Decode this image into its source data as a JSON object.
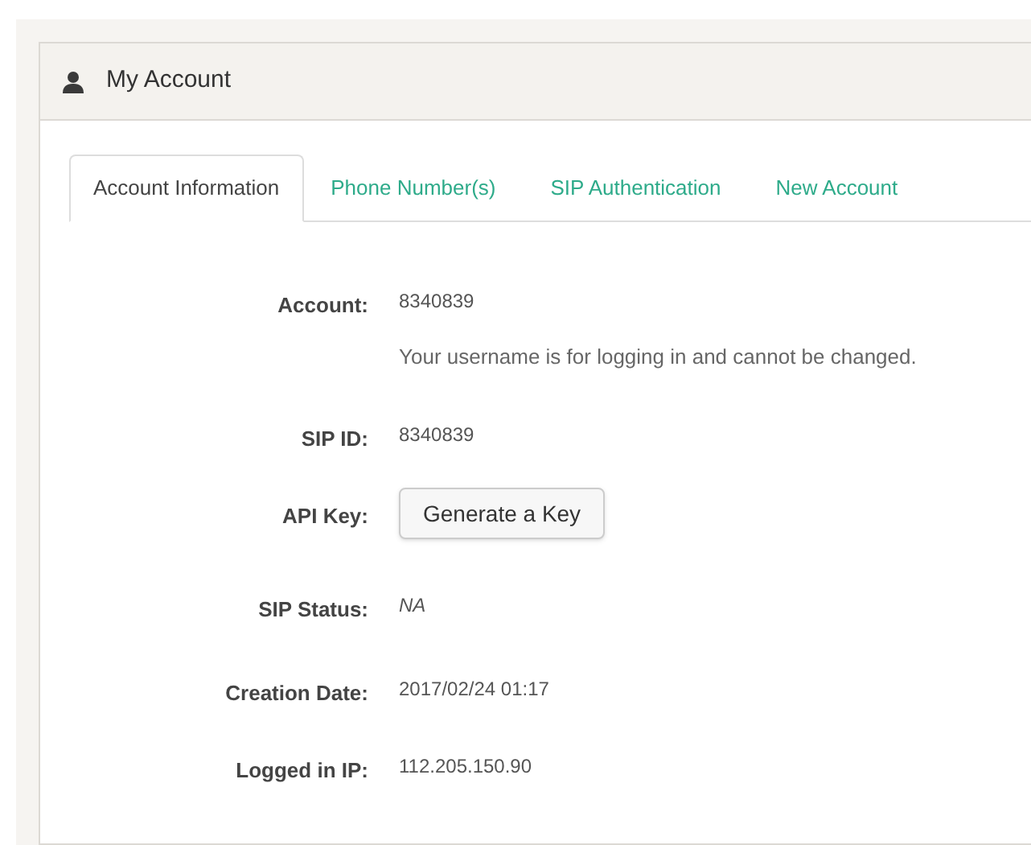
{
  "panel": {
    "title": "My Account"
  },
  "tabs": [
    {
      "label": "Account Information",
      "selected": true
    },
    {
      "label": "Phone Number(s)",
      "selected": false
    },
    {
      "label": "SIP Authentication",
      "selected": false
    },
    {
      "label": "New Account",
      "selected": false
    }
  ],
  "fields": [
    {
      "kind": "text",
      "label": "Account:",
      "value": "8340839",
      "note": "Your username is for logging in and cannot be changed."
    },
    {
      "kind": "text",
      "label": "SIP ID:",
      "value": "8340839"
    },
    {
      "kind": "button",
      "label": "API Key:",
      "value": "Generate a Key"
    },
    {
      "kind": "status",
      "label": "SIP Status:",
      "value": "NA"
    },
    {
      "kind": "text",
      "label": "Creation Date:",
      "value": "2017/02/24 01:17"
    },
    {
      "kind": "text",
      "label": "Logged in IP:",
      "value": "112.205.150.90"
    }
  ]
}
